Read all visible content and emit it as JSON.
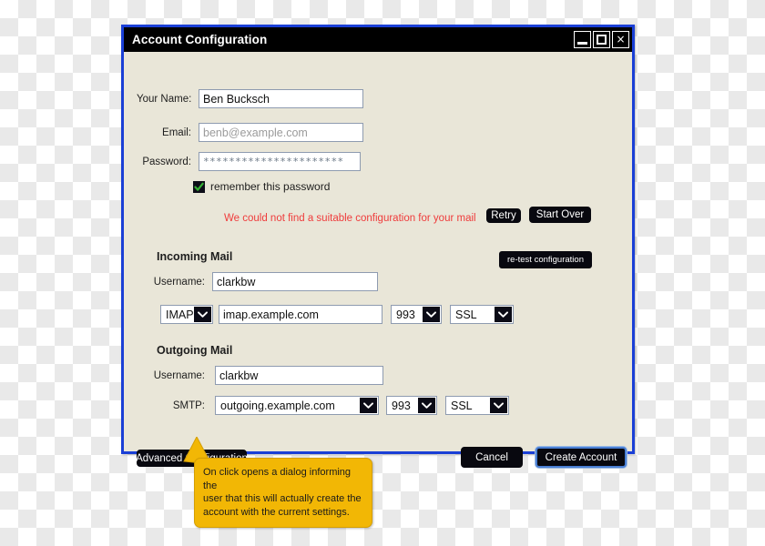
{
  "window": {
    "title": "Account Configuration",
    "controls": {
      "minimize": "minimize",
      "maximize": "maximize",
      "close": "×"
    }
  },
  "form": {
    "name": {
      "label": "Your Name:",
      "value": "Ben Bucksch"
    },
    "email": {
      "label": "Email:",
      "value": "",
      "placeholder": "benb@example.com"
    },
    "password": {
      "label": "Password:",
      "value": "**********************"
    },
    "remember": {
      "label": "remember this password",
      "checked": true,
      "check_glyph": "✔"
    }
  },
  "status": {
    "error_message": "We could not find a suitable configuration for your mail",
    "retry_label": "Retry",
    "start_over_label": "Start Over",
    "retest_label": "re-test configuration",
    "error_color": "#ef3b3b"
  },
  "incoming": {
    "section_title": "Incoming Mail",
    "username": {
      "label": "Username:",
      "value": "clarkbw"
    },
    "protocol": {
      "value": "IMAP"
    },
    "hostname": {
      "value": "imap.example.com"
    },
    "port": {
      "value": "993"
    },
    "security": {
      "value": "SSL"
    }
  },
  "outgoing": {
    "section_title": "Outgoing Mail",
    "username": {
      "label": "Username:",
      "value": "clarkbw"
    },
    "smtp_label": "SMTP:",
    "hostname": {
      "value": "outgoing.example.com"
    },
    "port": {
      "value": "993"
    },
    "security": {
      "value": "SSL"
    }
  },
  "footer": {
    "advanced_label": "Advanced Configuration",
    "cancel_label": "Cancel",
    "create_label": "Create Account"
  },
  "callout": {
    "line1": "On click opens a dialog informing the",
    "line2": "user that this will actually create the",
    "line3": "account with the current settings.",
    "color": "#F2B705"
  }
}
